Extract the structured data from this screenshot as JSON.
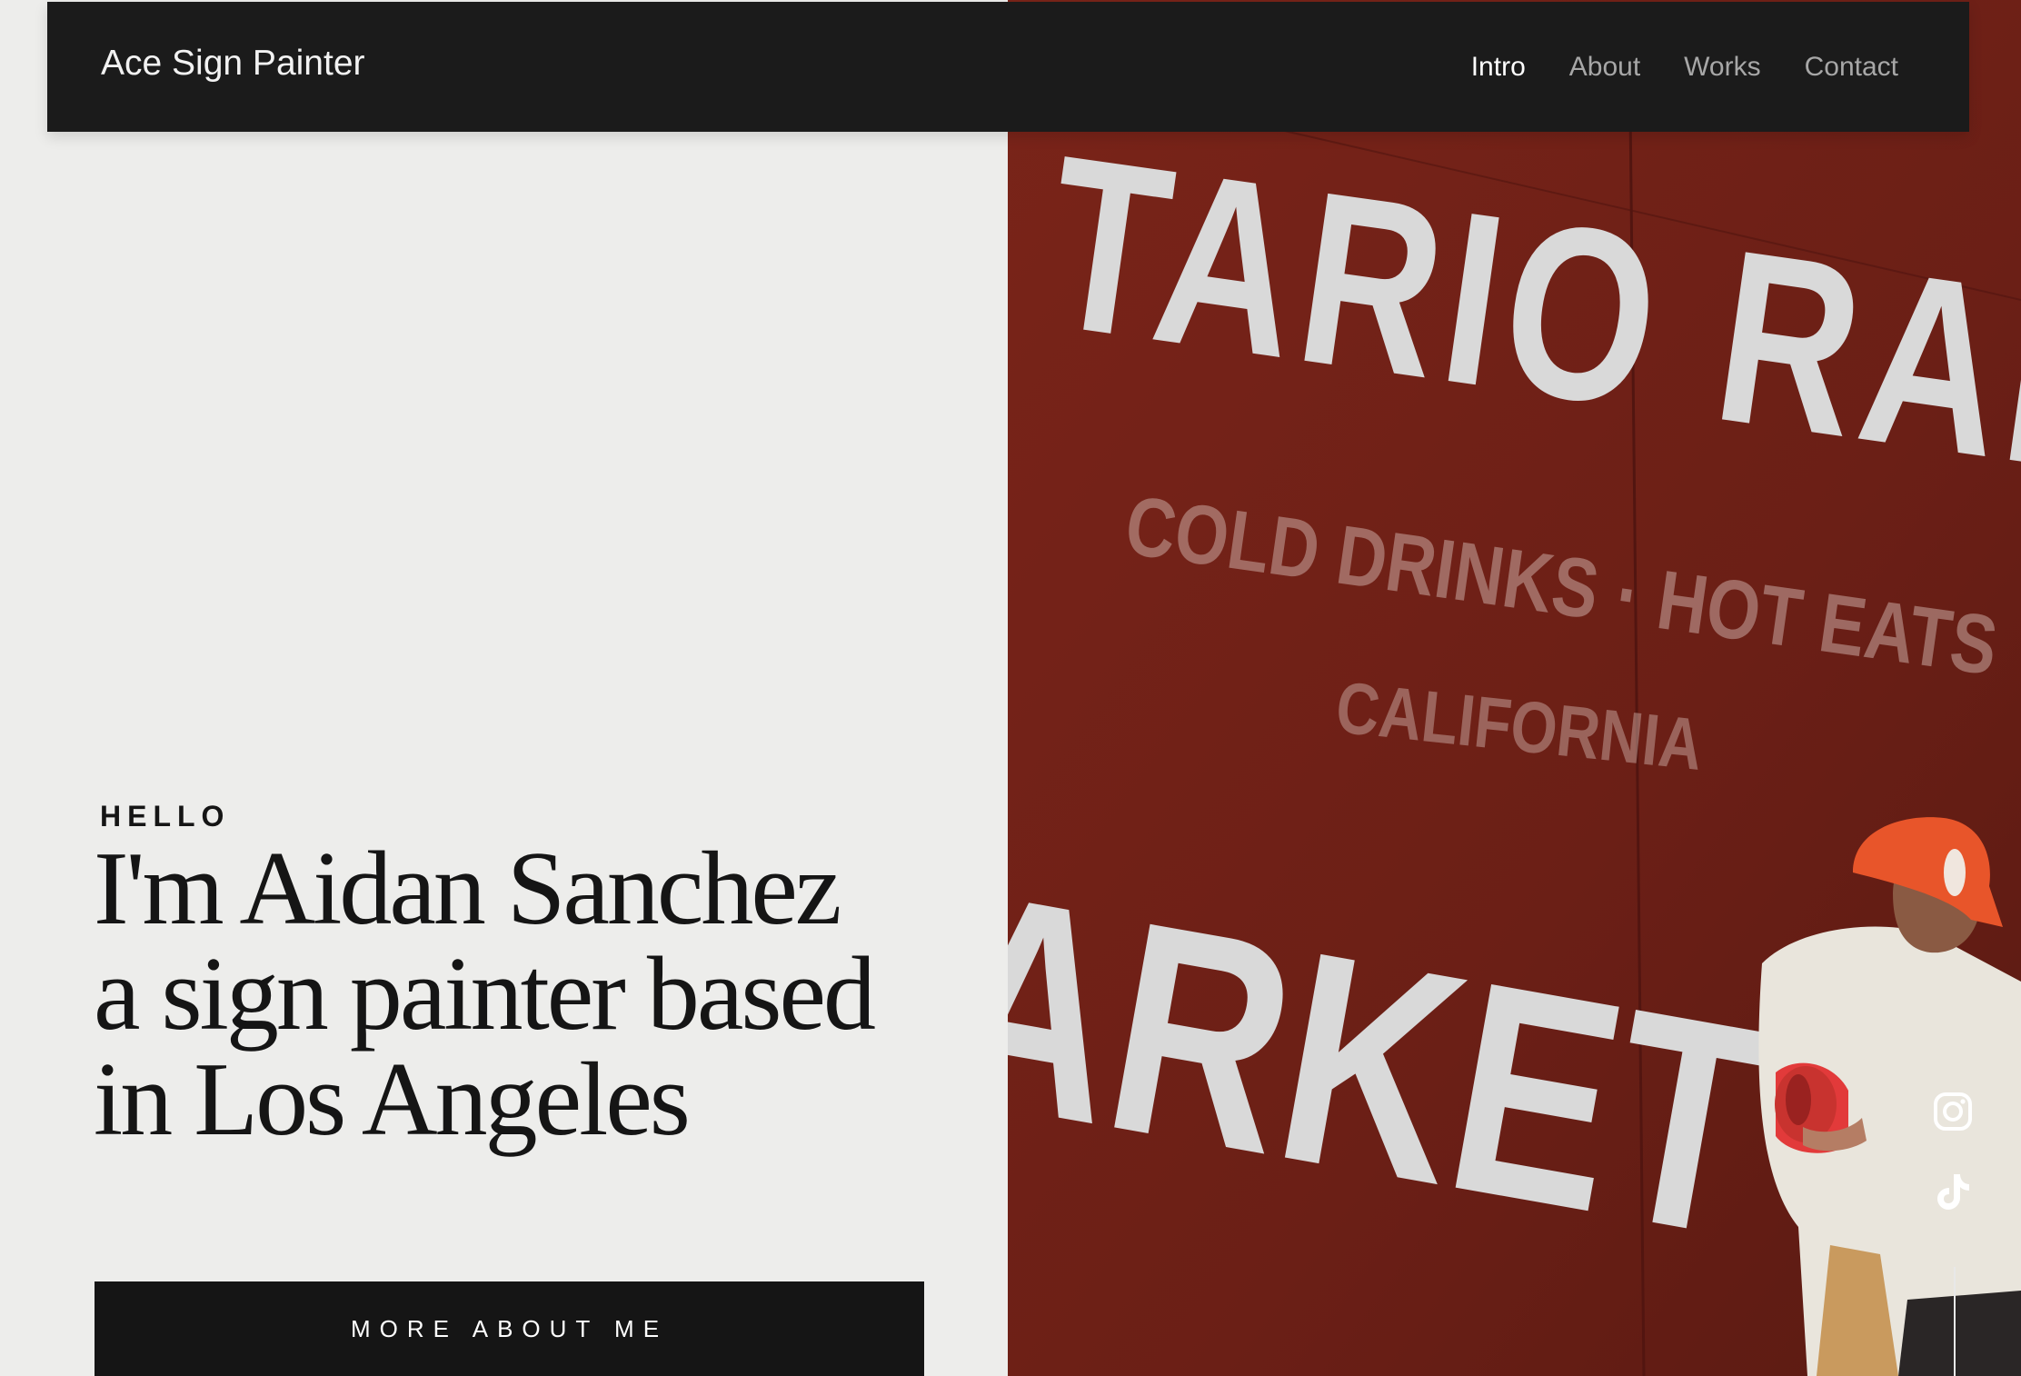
{
  "header": {
    "brand": "Ace Sign Painter",
    "nav": [
      {
        "label": "Intro",
        "active": true
      },
      {
        "label": "About",
        "active": false
      },
      {
        "label": "Works",
        "active": false
      },
      {
        "label": "Contact",
        "active": false
      }
    ]
  },
  "hero": {
    "eyebrow": "HELLO",
    "headline_lines": [
      "I'm Aidan Sanchez",
      "a sign painter based",
      "in Los Angeles"
    ],
    "cta_label": "MORE ABOUT ME"
  },
  "photo": {
    "mural_lines": [
      "TARIO RANC",
      "COLD DRINKS · HOT EATS",
      "CALIFORNIA",
      "ARKET"
    ],
    "wall_color": "#6a1e16",
    "paint_color": "#d9d9d9",
    "cap_color": "#e8552a"
  },
  "social": {
    "icons": [
      "instagram-icon",
      "tiktok-icon"
    ]
  },
  "colors": {
    "background": "#ededeb",
    "header_bg": "#1b1b1b",
    "text_dark": "#151515",
    "nav_inactive": "#a7a7a7",
    "nav_active": "#ffffff"
  }
}
